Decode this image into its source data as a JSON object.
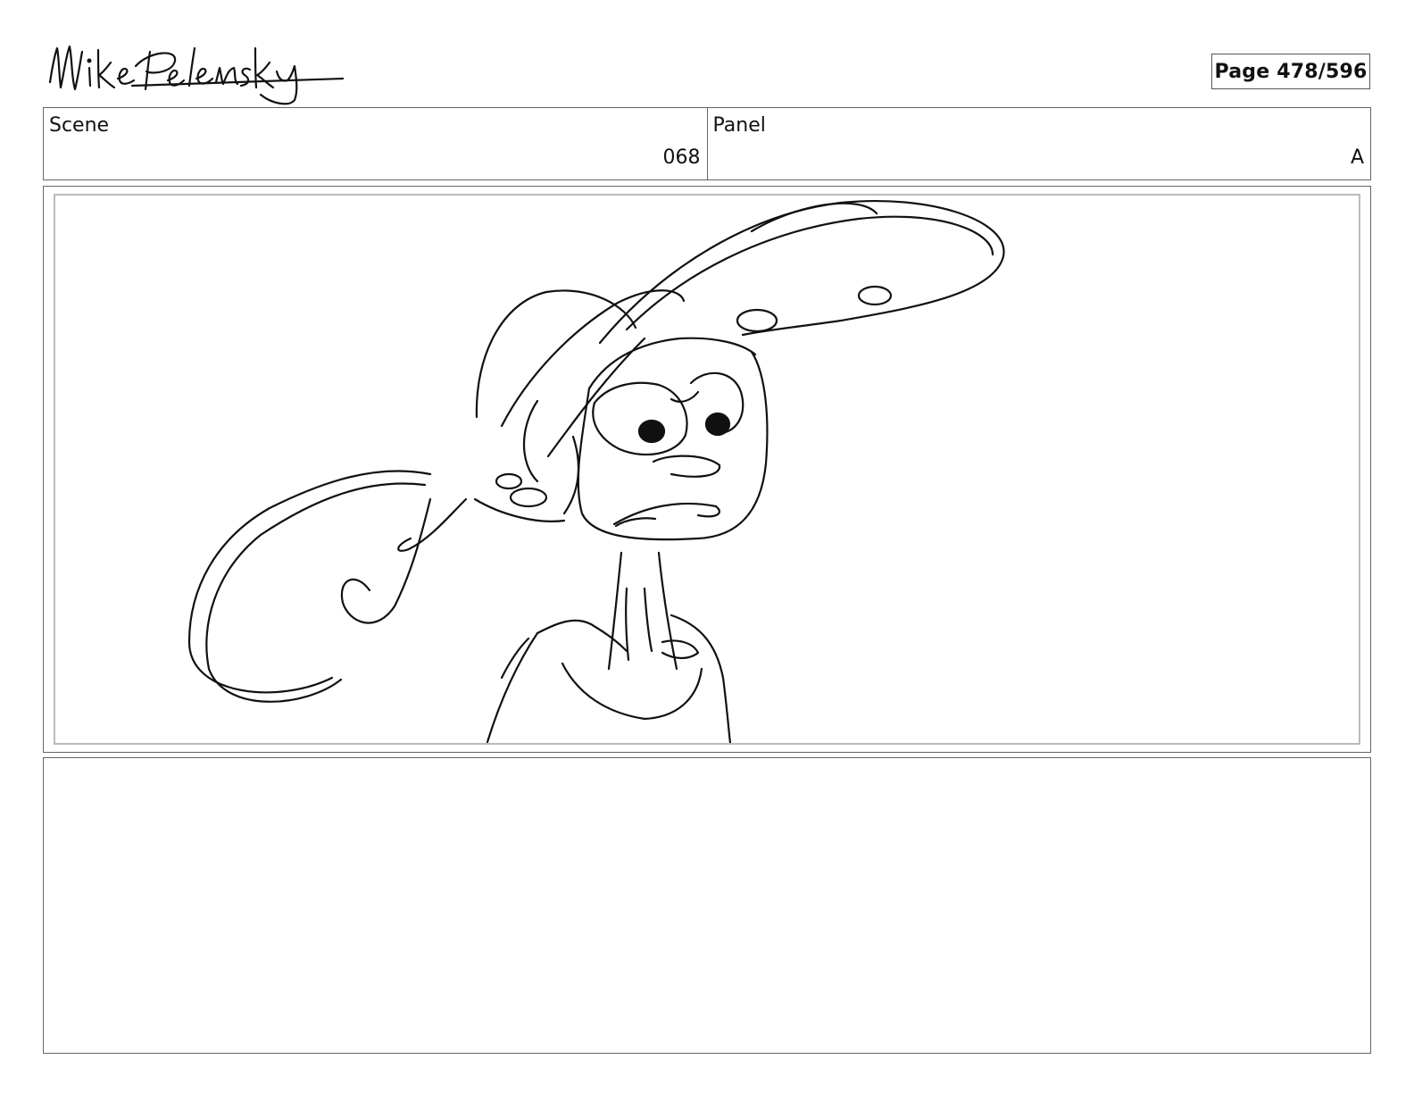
{
  "header": {
    "signature_text": "Mike Pelensky",
    "page_label": "Page 478/596"
  },
  "info": {
    "scene_label": "Scene",
    "scene_value": "068",
    "panel_label": "Panel",
    "panel_value": "A"
  },
  "notes": {
    "text": ""
  }
}
